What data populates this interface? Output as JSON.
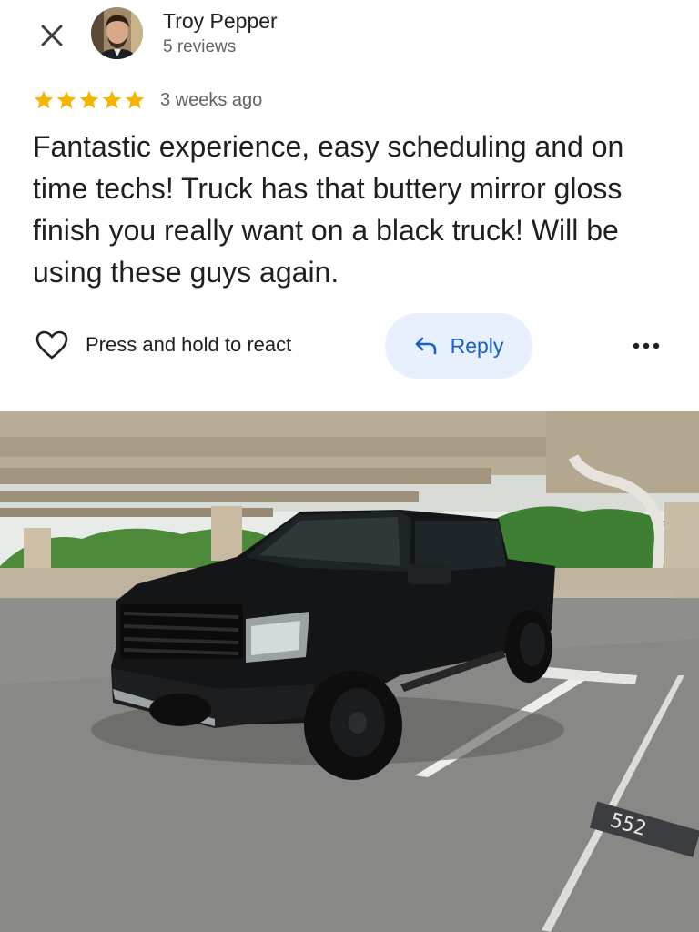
{
  "header": {
    "close_icon": "close-icon",
    "author_name": "Troy Pepper",
    "author_reviews": "5 reviews"
  },
  "review": {
    "rating": 5,
    "rating_max": 5,
    "date": "3 weeks ago",
    "text": "Fantastic experience, easy scheduling and on time techs! Truck has that buttery mirror gloss finish you really want on a black truck! Will be using these guys again."
  },
  "actions": {
    "react_label": "Press and hold to react",
    "reply_label": "Reply",
    "more_icon": "more-horizontal-icon"
  },
  "photo": {
    "parking_spot_number": "552"
  },
  "colors": {
    "star": "#f4b400",
    "reply_bg": "#e8f0fe",
    "reply_text": "#1a5fd0",
    "secondary_text": "#5f6368"
  }
}
